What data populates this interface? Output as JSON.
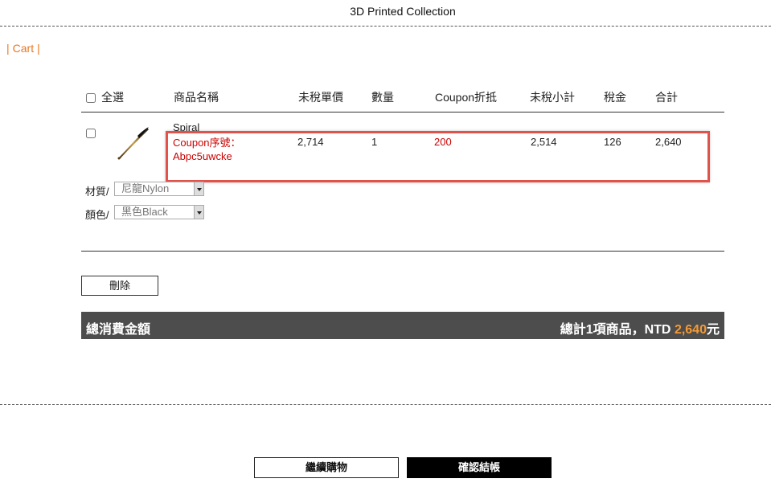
{
  "site": {
    "title": "3D Printed Collection"
  },
  "breadcrumb": {
    "label": "Cart",
    "sep": "|"
  },
  "table": {
    "headers": {
      "select_all": "全選",
      "product_name": "商品名稱",
      "unit_price_pretax": "未稅單價",
      "quantity": "數量",
      "coupon_discount": "Coupon折抵",
      "subtotal_pretax": "未稅小計",
      "tax": "稅金",
      "total": "合計"
    },
    "rows": [
      {
        "name": "Spiral",
        "coupon_label": "Coupon序號：",
        "coupon_code": "Abpc5uwcke",
        "unit_price": "2,714",
        "quantity": "1",
        "coupon_discount": "200",
        "subtotal": "2,514",
        "tax": "126",
        "total": "2,640",
        "options": [
          {
            "label": "材質/",
            "value": "尼龍Nylon"
          },
          {
            "label": "顏色/",
            "value": "黑色Black"
          }
        ]
      }
    ]
  },
  "actions": {
    "delete_label": "刪除"
  },
  "summary": {
    "label": "總消費金額",
    "prefix": "總計1項商品，NTD ",
    "amount": "2,640",
    "suffix": "元"
  },
  "footer": {
    "continue_label": "繼續購物",
    "checkout_label": "確認結帳"
  },
  "colors": {
    "accent": "#e87722",
    "coupon": "#cc0000",
    "highlight": "#e0524a",
    "summary_bg": "#4d4d4d",
    "summary_amount": "#f29a38"
  }
}
